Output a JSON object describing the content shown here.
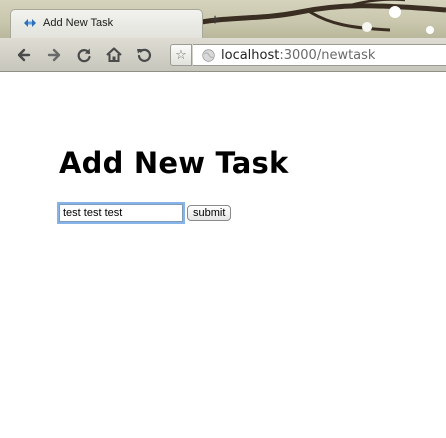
{
  "browser": {
    "tab_title": "Add New Task",
    "new_tab_label": "+",
    "url_host": "localhost",
    "url_rest": ":3000/newtask",
    "bookmark_star": "☆",
    "icons": {
      "tab_favicon": "diamond-arrows-icon",
      "back": "back-arrow-icon",
      "forward": "forward-arrow-icon",
      "reload": "reload-icon",
      "home": "home-icon",
      "history": "history-icon",
      "bookmark": "star-icon",
      "site": "globe-icon"
    }
  },
  "page": {
    "title": "Add New Task",
    "task_input_value": "test test test",
    "submit_label": "submit"
  },
  "colors": {
    "input_focus": "#86b3e8",
    "favicon": "#2f6fb7"
  }
}
